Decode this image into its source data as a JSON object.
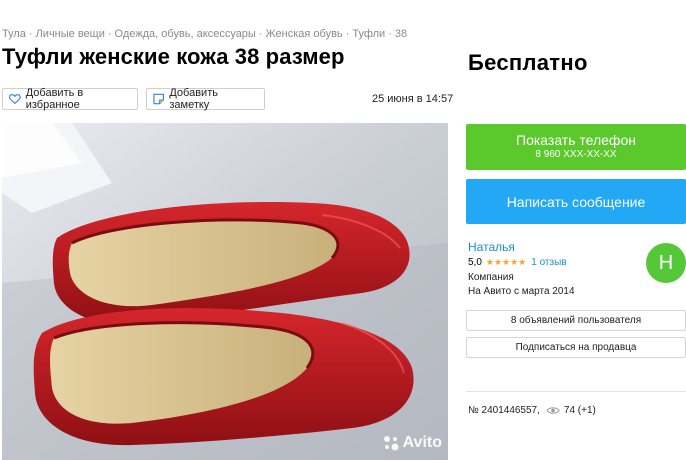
{
  "breadcrumbs": [
    "Тула",
    "Личные вещи",
    "Одежда, обувь, аксессуары",
    "Женская обувь",
    "Туфли",
    "38"
  ],
  "title": "Туфли женские кожа 38 размер",
  "actions": {
    "favorite_label": "Добавить в избранное",
    "note_label": "Добавить заметку"
  },
  "date": "25 июня в 14:57",
  "price": "Бесплатно",
  "contact": {
    "phone_label": "Показать телефон",
    "phone_masked": "8 960 XXX-XX-XX",
    "message_label": "Написать сообщение"
  },
  "seller": {
    "name": "Наталья",
    "rating": "5,0",
    "stars": "★★★★★",
    "reviews": "1 отзыв",
    "type": "Компания",
    "since": "На Авито с марта 2014",
    "avatar_letter": "Н",
    "avatar_color": "#55c83a",
    "ads_label": "8 объявлений пользователя",
    "subscribe_label": "Подписаться на продавца"
  },
  "listing": {
    "number": "№ 2401446557,",
    "views": "74 (+1)"
  },
  "photo": {
    "watermark": "Avito"
  },
  "colors": {
    "green": "#5bc92c",
    "blue": "#22a8f5",
    "link": "#1a8fd6",
    "star": "#f5a623"
  }
}
